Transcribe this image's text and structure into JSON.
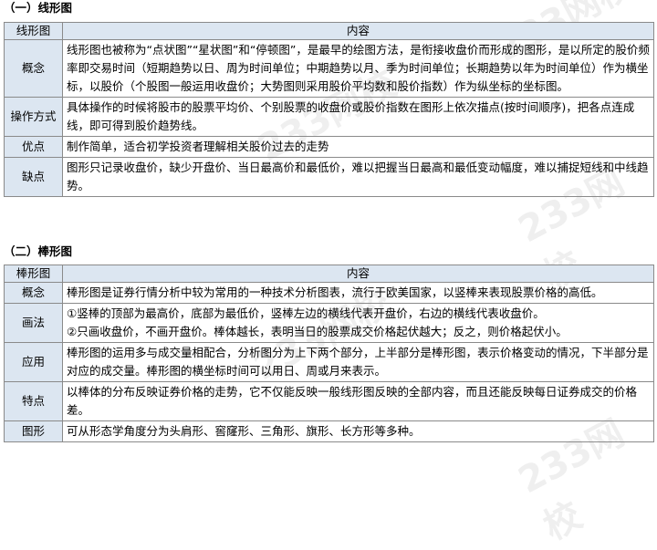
{
  "section1": {
    "title": "（一）线形图",
    "header": {
      "col1": "线形图",
      "col2": "内容"
    },
    "rows": [
      {
        "label": "概念",
        "content": "线形图也被称为“点状图”“星状图”和“停顿图”，是最早的绘图方法，是衔接收盘价而形成的图形，是以所定的股价频率即交易时间（短期趋势以日、周为时间单位；中期趋势以月、季为时间单位；长期趋势以年为时间单位）作为横坐标，以股价（个股图一般运用收盘价；大势图则采用股价平均数和股价指数）作为纵坐标的坐标图。"
      },
      {
        "label": "操作方式",
        "content": "具体操作的时候将股市的股票平均价、个别股票的收盘价或股价指数在图形上依次描点(按时间顺序)，把各点连成线，即可得到股价趋势线。"
      },
      {
        "label": "优点",
        "content": "制作简单，适合初学投资者理解相关股价过去的走势"
      },
      {
        "label": "缺点",
        "content": "图形只记录收盘价，缺少开盘价、当日最高价和最低价，难以把握当日最高和最低变动幅度，难以捕捉短线和中线趋势。"
      }
    ]
  },
  "section2": {
    "title": "（二）棒形图",
    "header": {
      "col1": "棒形图",
      "col2": "内容"
    },
    "rows": [
      {
        "label": "概念",
        "content": "棒形图是证券行情分析中较为常用的一种技术分析图表，流行于欧美国家，以竖棒来表现股票价格的高低。"
      },
      {
        "label": "画法",
        "content": "①竖棒的顶部为最高价，底部为最低价，竖棒左边的横线代表开盘价，右边的横线代表收盘价。",
        "content2": "②只画收盘价，不画开盘价。棒体越长，表明当日的股票成交价格起伏越大；反之，则价格起伏小。"
      },
      {
        "label": "应用",
        "content": "棒形图的运用多与成交量相配合，分析图分为上下两个部分，上半部分是棒形图，表示价格变动的情况，下半部分是对应的成交量。棒形图的横坐标时间可以用日、周或月来表示。"
      },
      {
        "label": "特点",
        "content": "以棒体的分布反映证券价格的走势，它不仅能反映一般线形图反映的全部内容，而且还能反映每日证券成交的价格差。"
      },
      {
        "label": "图形",
        "content": "可从形态学角度分为头肩形、窖窿形、三角形、旗形、长方形等多种。"
      }
    ]
  },
  "watermark": "233网校"
}
